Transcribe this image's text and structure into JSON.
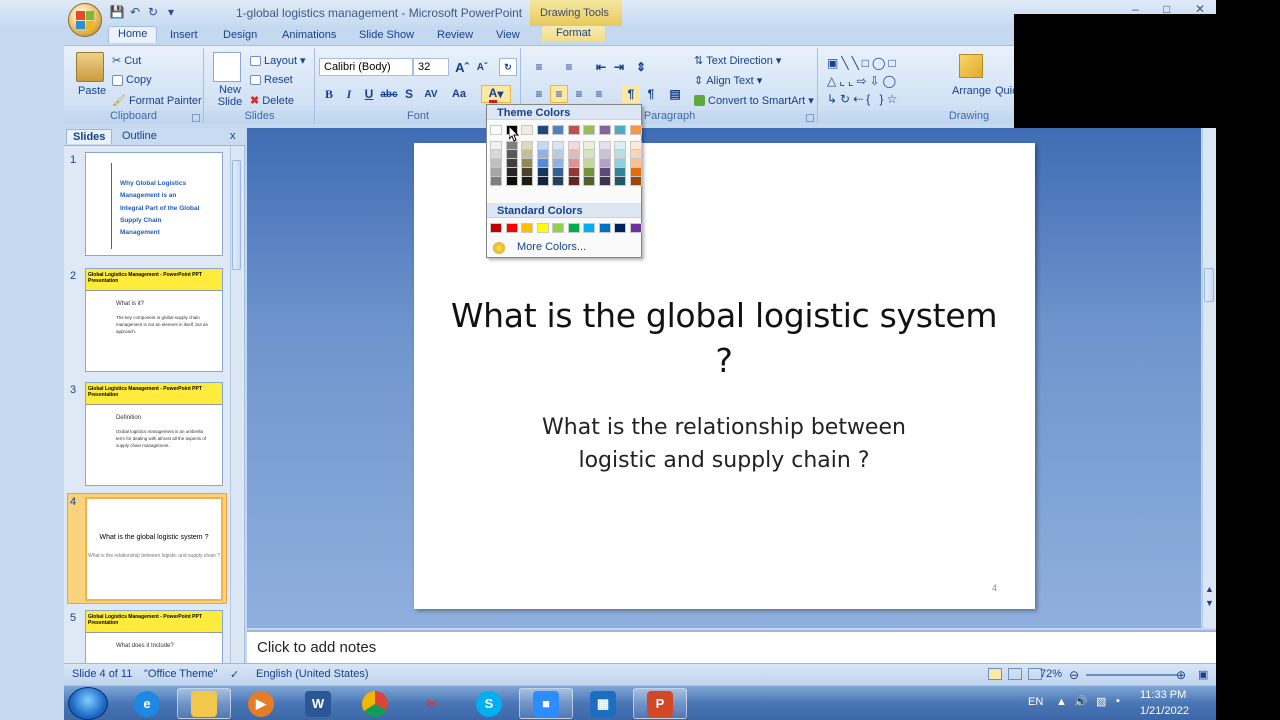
{
  "window": {
    "title": "1-global logistics management - Microsoft PowerPoint",
    "contextual_tab": "Drawing Tools",
    "minimize": "–",
    "restore": "□",
    "close": "✕"
  },
  "tabs": [
    "Home",
    "Insert",
    "Design",
    "Animations",
    "Slide Show",
    "Review",
    "View",
    "Format"
  ],
  "ribbon": {
    "clipboard": {
      "label": "Clipboard",
      "paste": "Paste",
      "cut": "Cut",
      "copy": "Copy",
      "format_painter": "Format Painter"
    },
    "slides": {
      "label": "Slides",
      "new_slide": "New Slide",
      "layout": "Layout",
      "reset": "Reset",
      "delete": "Delete"
    },
    "font": {
      "label": "Font",
      "font_name": "Calibri (Body)",
      "font_size": "32"
    },
    "paragraph": {
      "label": "Paragraph",
      "text_direction": "Text Direction",
      "align_text": "Align Text",
      "convert_smartart": "Convert to SmartArt"
    },
    "drawing": {
      "label": "Drawing",
      "arrange": "Arrange",
      "quick_styles": "Quick Styles"
    }
  },
  "slides_pane": {
    "tabs": [
      "Slides",
      "Outline"
    ],
    "close": "x",
    "thumbnails": [
      {
        "num": "1",
        "title": "Why Global Logistics Management is an Integral Part of the Global Supply Chain Management"
      },
      {
        "num": "2",
        "header": "Global Logistics Management - PowerPoint PPT Presentation",
        "title": "What is it?",
        "body": "The key component in global supply chain management is not an element in itself, but an approach."
      },
      {
        "num": "3",
        "header": "Global Logistics Management - PowerPoint PPT Presentation",
        "title": "Definition",
        "body": "Global logistics management is an umbrella term for dealing with almost all the aspects of supply chain management."
      },
      {
        "num": "4",
        "title": "What is the global logistic system ?",
        "body": "What is the relationship between logistic and supply chain ?"
      },
      {
        "num": "5",
        "header": "Global Logistics Management - PowerPoint PPT Presentation",
        "title": "What does it Include?"
      }
    ]
  },
  "slide": {
    "title": "What is the global logistic system ?",
    "subtitle_line1": "What is the relationship between",
    "subtitle_line2": "logistic and supply chain ?",
    "number": "4"
  },
  "notes": {
    "placeholder": "Click to add notes"
  },
  "status": {
    "slide_info": "Slide 4 of 11",
    "theme": "\"Office Theme\"",
    "language": "English (United States)",
    "zoom": "72%"
  },
  "color_menu": {
    "theme_header": "Theme Colors",
    "standard_header": "Standard Colors",
    "more_colors": "More Colors...",
    "theme_colors": [
      "#ffffff",
      "#000000",
      "#eeece1",
      "#1f497d",
      "#4f81bd",
      "#c0504d",
      "#9bbb59",
      "#8064a2",
      "#4bacc6",
      "#f79646"
    ],
    "theme_tints": [
      [
        "#f2f2f2",
        "#d8d8d8",
        "#bfbfbf",
        "#a5a5a5",
        "#7f7f7f"
      ],
      [
        "#7f7f7f",
        "#595959",
        "#3f3f3f",
        "#262626",
        "#0c0c0c"
      ],
      [
        "#ddd9c3",
        "#c4bd97",
        "#938953",
        "#494429",
        "#1d1b10"
      ],
      [
        "#c6d9f0",
        "#8db3e2",
        "#548dd4",
        "#17365d",
        "#0f243e"
      ],
      [
        "#dbe5f1",
        "#b8cce4",
        "#95b3d7",
        "#366092",
        "#244061"
      ],
      [
        "#f2dcdb",
        "#e5b9b7",
        "#d99694",
        "#953734",
        "#632423"
      ],
      [
        "#ebf1dd",
        "#d7e3bc",
        "#c3d69b",
        "#76923c",
        "#4f6128"
      ],
      [
        "#e5e0ec",
        "#ccc1d9",
        "#b2a2c7",
        "#5f497a",
        "#3f3151"
      ],
      [
        "#dbeef3",
        "#b7dde8",
        "#92cddc",
        "#31859b",
        "#205867"
      ],
      [
        "#fdeada",
        "#fbd5b5",
        "#fac08f",
        "#e36c09",
        "#974806"
      ]
    ],
    "standard_colors": [
      "#c00000",
      "#ff0000",
      "#ffc000",
      "#ffff00",
      "#92d050",
      "#00b050",
      "#00b0f0",
      "#0070c0",
      "#002060",
      "#7030a0"
    ]
  },
  "taskbar": {
    "apps": [
      "Internet Explorer",
      "File Explorer",
      "Media Player",
      "Word",
      "Chrome",
      "Snipping Tool",
      "Skype",
      "Zoom",
      "Video",
      "PowerPoint"
    ],
    "lang": "EN",
    "time": "11:33 PM",
    "date": "1/21/2022"
  }
}
